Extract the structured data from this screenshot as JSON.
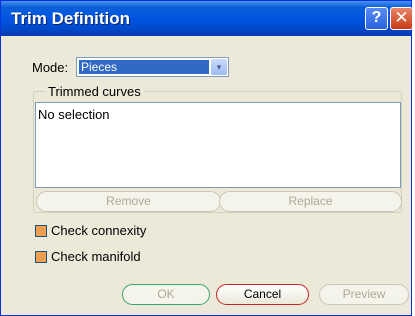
{
  "window": {
    "title": "Trim Definition",
    "help_glyph": "?",
    "close_glyph": "✕"
  },
  "mode": {
    "label": "Mode:",
    "value": "Pieces",
    "dropdown_glyph": "▾"
  },
  "trimmed_curves": {
    "label": "Trimmed curves",
    "list_text": "No selection",
    "remove_label": "Remove",
    "replace_label": "Replace"
  },
  "options": {
    "check_connexity_label": "Check connexity",
    "check_manifold_label": "Check manifold"
  },
  "buttons": {
    "ok_label": "OK",
    "cancel_label": "Cancel",
    "preview_label": "Preview"
  },
  "colors": {
    "titlebar": "#0054e3",
    "window_bg": "#ece9d8",
    "selection": "#316ac5",
    "checkbox_fill": "#f0a050"
  }
}
